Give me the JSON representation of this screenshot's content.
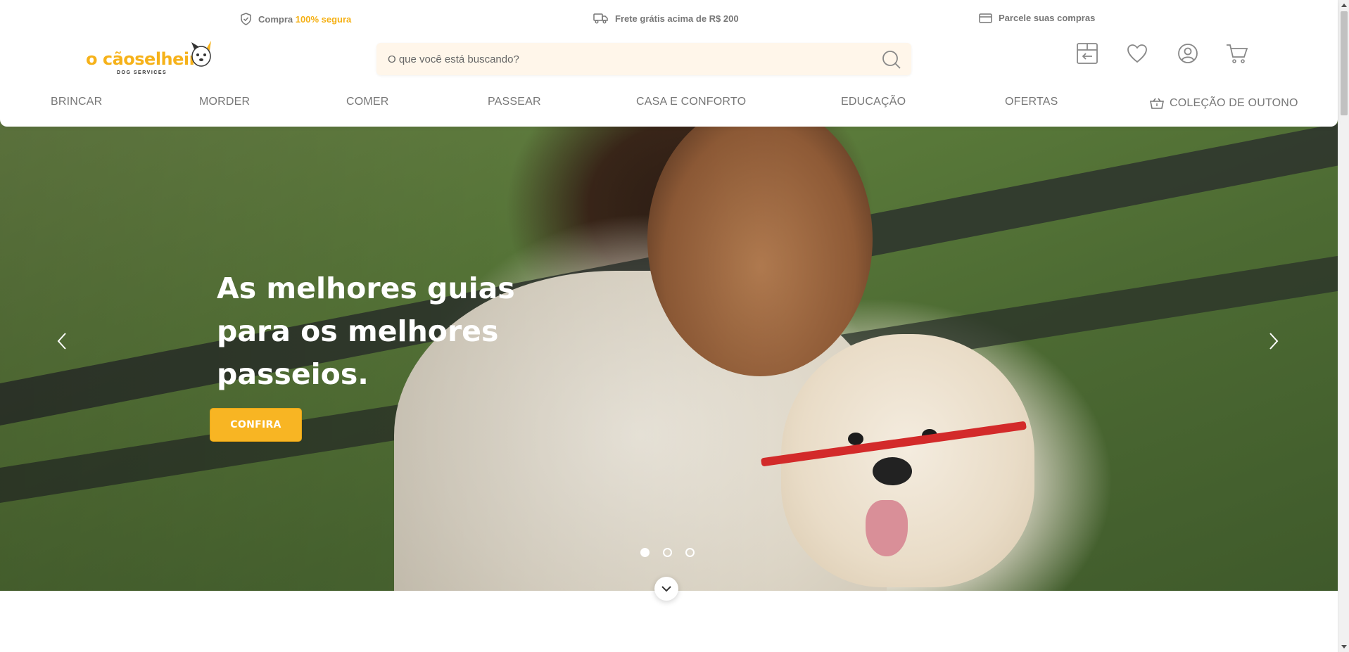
{
  "topbar": {
    "secure_prefix": "Compra",
    "secure_highlight": "100% segura",
    "shipping": "Frete grátis acima de R$ 200",
    "installments": "Parcele suas compras"
  },
  "logo": {
    "wordmark": "o cãoselheiro",
    "tagline": "DOG SERVICES"
  },
  "search": {
    "placeholder": "O que você está buscando?"
  },
  "nav": {
    "items": [
      "BRINCAR",
      "MORDER",
      "COMER",
      "PASSEAR",
      "CASA E CONFORTO",
      "EDUCAÇÃO",
      "OFERTAS",
      "COLEÇÃO DE OUTONO"
    ]
  },
  "hero": {
    "headline_line1": "As melhores guias",
    "headline_line2": "para os melhores",
    "headline_line3": "passeios.",
    "cta_label": "CONFIRA",
    "slides_total": 3,
    "active_slide": 1
  },
  "colors": {
    "accent": "#f8b523",
    "search_bg": "#fff6ea",
    "text_muted": "#777777"
  },
  "icons": [
    "shield-check-icon",
    "truck-icon",
    "credit-card-icon",
    "search-icon",
    "box-return-icon",
    "heart-icon",
    "user-icon",
    "cart-icon",
    "basket-icon",
    "chevron-left-icon",
    "chevron-right-icon",
    "chevron-down-icon"
  ]
}
